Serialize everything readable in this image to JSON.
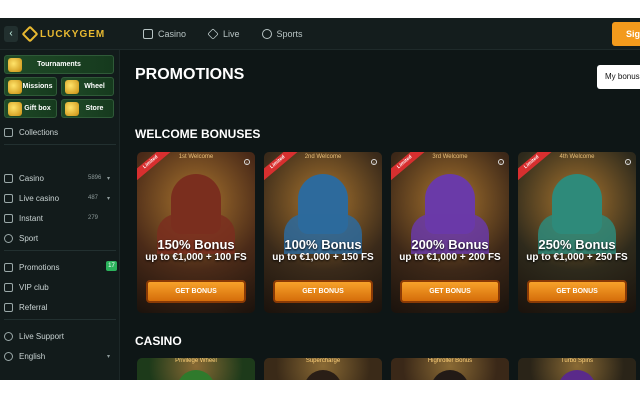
{
  "brand": {
    "name": "LUCKYGEM",
    "accent": "#e8b931"
  },
  "topnav": {
    "back_icon": "chevron-left-icon",
    "items": [
      {
        "label": "Casino",
        "icon": "casino-icon"
      },
      {
        "label": "Live",
        "icon": "live-diamond-icon"
      },
      {
        "label": "Sports",
        "icon": "ball-icon"
      }
    ],
    "signup_label": "Sig"
  },
  "sidebar": {
    "tiles": [
      {
        "label": "Tournaments"
      },
      {
        "label": "Missions"
      },
      {
        "label": "Wheel"
      },
      {
        "label": "Gift box"
      },
      {
        "label": "Store"
      }
    ],
    "collections_label": "Collections",
    "items": [
      {
        "label": "Casino",
        "count": "5896",
        "has_chevron": true,
        "icon": "casino-icon"
      },
      {
        "label": "Live casino",
        "count": "487",
        "has_chevron": true,
        "icon": "live-icon"
      },
      {
        "label": "Instant",
        "count": "279",
        "has_chevron": false,
        "icon": "bolt-icon"
      },
      {
        "label": "Sport",
        "count": "",
        "has_chevron": false,
        "icon": "ball-icon"
      }
    ],
    "items2": [
      {
        "label": "Promotions",
        "badge": "17",
        "icon": "gift-icon"
      },
      {
        "label": "VIP club",
        "icon": "crown-icon"
      },
      {
        "label": "Referral",
        "icon": "referral-icon"
      }
    ],
    "items3": [
      {
        "label": "Live Support",
        "icon": "support-icon"
      },
      {
        "label": "English",
        "icon": "globe-icon",
        "has_chevron": true
      }
    ],
    "chevron": "▾"
  },
  "main": {
    "title": "PROMOTIONS",
    "my_bonus_label": "My bonus",
    "welcome_title": "WELCOME BONUSES",
    "casino_title": "CASINO",
    "welcome_cards": [
      {
        "ribbon": "Limited",
        "kicker": "1st Welcome",
        "title": "150% Bonus",
        "sub": "up to €1,000 + 100 FS",
        "button": "GET BONUS",
        "bg": "#4a2a18",
        "char": "#7a2e1e"
      },
      {
        "ribbon": "Limited",
        "kicker": "2nd Welcome",
        "title": "100% Bonus",
        "sub": "up to €1,000 + 150 FS",
        "button": "GET BONUS",
        "bg": "#3a2a1a",
        "char": "#2d6a9c"
      },
      {
        "ribbon": "Limited",
        "kicker": "3rd Welcome",
        "title": "200% Bonus",
        "sub": "up to €1,000 + 200 FS",
        "button": "GET BONUS",
        "bg": "#3d2818",
        "char": "#6a3aa8"
      },
      {
        "ribbon": "Limited",
        "kicker": "4th Welcome",
        "title": "250% Bonus",
        "sub": "up to €1,000 + 250 FS",
        "button": "GET BONUS",
        "bg": "#2e2a1c",
        "char": "#2e8a7a"
      }
    ],
    "casino_cards": [
      {
        "label": "Privilege Wheel",
        "bg": "#1d3a1a",
        "head": "#2f7a2c"
      },
      {
        "label": "Supercharge",
        "bg": "#3a2a18",
        "head": "#2a1e16"
      },
      {
        "label": "Highroller Bonus",
        "bg": "#3a2818",
        "head": "#221a16"
      },
      {
        "label": "Turbo Spins",
        "bg": "#2a2418",
        "head": "#5a2a8a"
      }
    ]
  }
}
